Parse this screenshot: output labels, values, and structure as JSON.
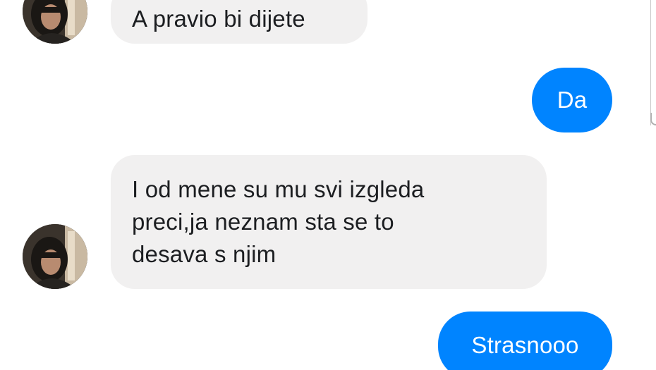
{
  "conversation": {
    "messages": [
      {
        "direction": "incoming",
        "text": "A pravio bi dijete",
        "has_avatar": true
      },
      {
        "direction": "outgoing",
        "text": "Da"
      },
      {
        "direction": "incoming",
        "lines": [
          "I od mene su mu svi izgleda",
          "preci,ja neznam sta se to",
          "desava s njim"
        ],
        "has_avatar": true
      },
      {
        "direction": "outgoing",
        "text": "Strasnooo"
      }
    ]
  },
  "avatar": {
    "icon": "contact-photo-avatar"
  },
  "colors": {
    "incoming_bubble": "#f1f0f0",
    "incoming_text": "#1c1e21",
    "outgoing_bubble": "#0084ff",
    "outgoing_text": "#ffffff",
    "background": "#ffffff"
  }
}
